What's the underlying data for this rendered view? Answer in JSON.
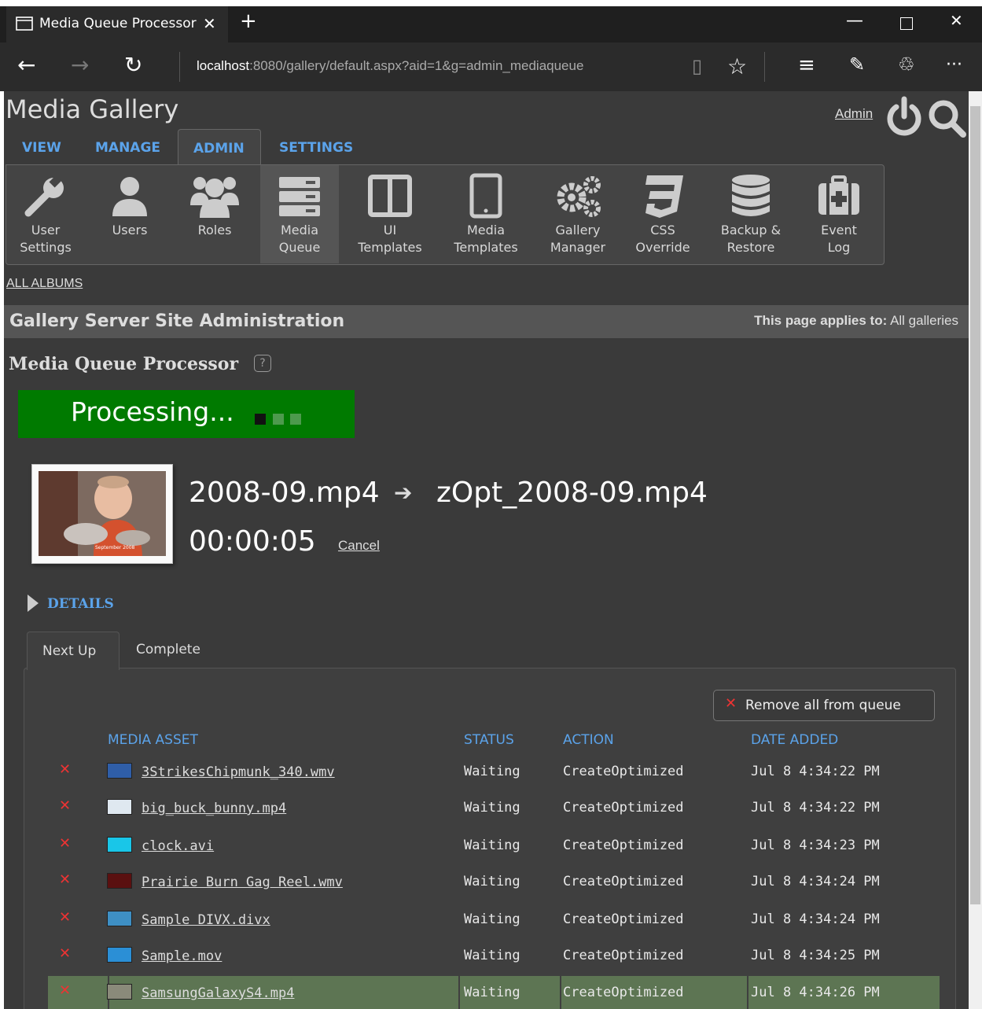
{
  "browser": {
    "tab_title": "Media Queue Processor",
    "url_host": "localhost",
    "url_rest": ":8080/gallery/default.aspx?aid=1&g=admin_mediaqueue"
  },
  "header": {
    "site_title": "Media Gallery",
    "user_link": "Admin"
  },
  "nav_tabs": [
    {
      "label": "VIEW"
    },
    {
      "label": "MANAGE"
    },
    {
      "label": "ADMIN"
    },
    {
      "label": "SETTINGS"
    }
  ],
  "toolbar": [
    {
      "l1": "User",
      "l2": "Settings",
      "icon": "wrench-icon"
    },
    {
      "l1": "Users",
      "l2": "",
      "icon": "user-icon"
    },
    {
      "l1": "Roles",
      "l2": "",
      "icon": "users-icon"
    },
    {
      "l1": "Media",
      "l2": "Queue",
      "icon": "server-icon"
    },
    {
      "l1": "UI",
      "l2": "Templates",
      "icon": "columns-icon"
    },
    {
      "l1": "Media",
      "l2": "Templates",
      "icon": "tablet-icon"
    },
    {
      "l1": "Gallery",
      "l2": "Manager",
      "icon": "gears-icon"
    },
    {
      "l1": "CSS",
      "l2": "Override",
      "icon": "css3-icon"
    },
    {
      "l1": "Backup &",
      "l2": "Restore",
      "icon": "database-icon"
    },
    {
      "l1": "Event",
      "l2": "Log",
      "icon": "medkit-icon"
    }
  ],
  "breadcrumb": "ALL ALBUMS",
  "admin_bar": {
    "title": "Gallery Server Site Administration",
    "applies_label": "This page applies to:",
    "applies_value": "All galleries"
  },
  "page_title": "Media Queue Processor",
  "help_glyph": "?",
  "status": {
    "text": "Processing...",
    "color": "#007a00"
  },
  "current": {
    "source": "2008-09.mp4",
    "target": "zOpt_2008-09.mp4",
    "elapsed": "00:00:05",
    "cancel_label": "Cancel",
    "thumb_caption": "September 2008"
  },
  "details_label": "DETAILS",
  "queue_tabs": [
    {
      "label": "Next Up"
    },
    {
      "label": "Complete"
    }
  ],
  "remove_all_label": "Remove all from queue",
  "table": {
    "headers": [
      "MEDIA ASSET",
      "STATUS",
      "ACTION",
      "DATE ADDED"
    ],
    "rows": [
      {
        "name": "3StrikesChipmunk_340.wmv",
        "status": "Waiting",
        "action": "CreateOptimized",
        "date": "Jul 8 4:34:22 PM",
        "thumb": "#2f5ea8"
      },
      {
        "name": "big_buck_bunny.mp4",
        "status": "Waiting",
        "action": "CreateOptimized",
        "date": "Jul 8 4:34:22 PM",
        "thumb": "#dfe8f0"
      },
      {
        "name": "clock.avi",
        "status": "Waiting",
        "action": "CreateOptimized",
        "date": "Jul 8 4:34:23 PM",
        "thumb": "#19c6e8"
      },
      {
        "name": "Prairie Burn Gag Reel.wmv",
        "status": "Waiting",
        "action": "CreateOptimized",
        "date": "Jul 8 4:34:24 PM",
        "thumb": "#5a1010"
      },
      {
        "name": "Sample DIVX.divx",
        "status": "Waiting",
        "action": "CreateOptimized",
        "date": "Jul 8 4:34:24 PM",
        "thumb": "#3e8fc4"
      },
      {
        "name": "Sample.mov",
        "status": "Waiting",
        "action": "CreateOptimized",
        "date": "Jul 8 4:34:25 PM",
        "thumb": "#2b8fd6"
      },
      {
        "name": "SamsungGalaxyS4.mp4",
        "status": "Waiting",
        "action": "CreateOptimized",
        "date": "Jul 8 4:34:26 PM",
        "thumb": "#8a8a7a"
      }
    ]
  }
}
